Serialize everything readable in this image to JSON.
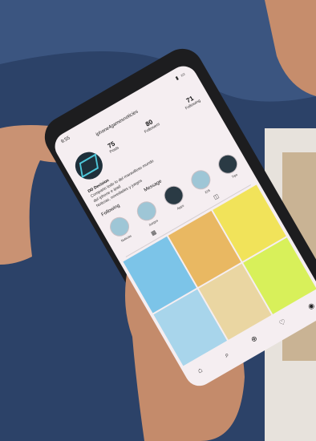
{
  "status_bar": {
    "time": "9:55",
    "signal_icon": "signal-icon",
    "battery_icon": "battery-icon"
  },
  "profile": {
    "username": "iphone4gamesnoticies",
    "stats": [
      {
        "value": "75",
        "label": "Posts"
      },
      {
        "value": "80",
        "label": "Followers"
      },
      {
        "value": "71",
        "label": "Following"
      }
    ],
    "display_name": "DD Decision",
    "bio_lines": [
      "Comparto todo lo del maravilloso mundo",
      "del iphone e ipad",
      "Noticias, novedades y juegos"
    ]
  },
  "buttons": {
    "following": "Following",
    "message": "Message"
  },
  "highlights": [
    "Noticias",
    "Juegos",
    "Apps",
    "iOS",
    "Tips"
  ],
  "tabs": {
    "grid_icon": "grid-icon",
    "tagged_icon": "tagged-icon"
  },
  "bottom_nav": [
    "home-icon",
    "search-icon",
    "add-icon",
    "heart-icon",
    "profile-icon"
  ],
  "colors": {
    "screen_bg": "#f5eef1",
    "accent": "#4ec6d8",
    "jeans": "#2a3f63",
    "skin": "#c99273"
  }
}
